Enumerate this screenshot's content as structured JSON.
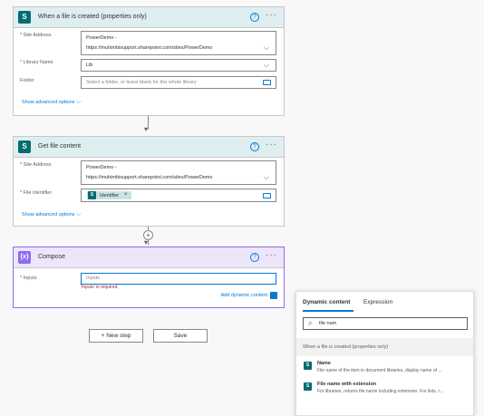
{
  "trigger": {
    "title": "When a file is created (properties only)",
    "site_label": "* Site Address",
    "site_value_line1": "PowerDemo -",
    "site_value_line2": "https://muhimbisupport.sharepoint.com/sites/PowerDemo",
    "library_label": "* Library Name",
    "library_value": "Lib",
    "folder_label": "Folder",
    "folder_placeholder": "Select a folder, or leave blank for the whole library",
    "advanced": "Show advanced options"
  },
  "get_file": {
    "title": "Get file content",
    "site_label": "* Site Address",
    "site_value_line1": "PowerDemo -",
    "site_value_line2": "https://muhimbisupport.sharepoint.com/sites/PowerDemo",
    "file_label": "* File Identifier",
    "token_label": "Identifier",
    "advanced": "Show advanced options"
  },
  "compose": {
    "title": "Compose",
    "inputs_label": "* Inputs",
    "inputs_placeholder": "Inputs",
    "error": "'Inputs' is required.",
    "add_dynamic": "Add dynamic content"
  },
  "actions": {
    "new_step": "+ New step",
    "save": "Save"
  },
  "dynamic_panel": {
    "tab_dynamic": "Dynamic content",
    "tab_expression": "Expression",
    "search_value": "file nam",
    "section_header": "When a file is created (properties only)",
    "items": [
      {
        "title": "Name",
        "desc": "File name of the item in document libraries, display name of ..."
      },
      {
        "title": "File name with extension",
        "desc": "For libraries, returns file name including extension. For lists, r..."
      }
    ]
  },
  "colors": {
    "accent": "#0078d4",
    "sharepoint": "#036c70",
    "compose": "#8c6cf2",
    "error": "#a4262c"
  }
}
